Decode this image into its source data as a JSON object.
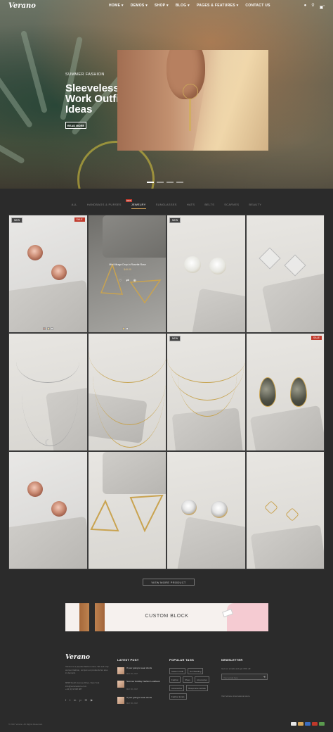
{
  "brand": {
    "logo": "Verano"
  },
  "nav": {
    "items": [
      "HOME ▾",
      "DEMOS ▾",
      "SHOP ▾",
      "BLOG ▾",
      "PAGES & FEATURES ▾",
      "CONTACT US"
    ],
    "icons": [
      "user-icon",
      "search-icon",
      "cart-icon"
    ],
    "cart_count": "0"
  },
  "hero": {
    "kicker": "SUMMER FASHION",
    "headline": "Sleeveless Work Outfit Ideas",
    "button": "READ MORE",
    "slides": 4,
    "active_slide": 1
  },
  "filters": {
    "tabs": [
      "ALL",
      "HANDBAGS & PURSES",
      "JEWELRY",
      "SUNGLASSES",
      "HATS",
      "BELTS",
      "SCARVES",
      "BEAUTY"
    ],
    "active": "JEWELRY",
    "new_badge": "NEW"
  },
  "products": {
    "badge_new": "NEW",
    "badge_sale": "SALE",
    "hover_name": "Mini Mirage Drop in Rosette Rose",
    "hover_price": "$49.00",
    "hover_stars": "☆☆☆☆☆",
    "hover_actions": [
      "♡",
      "⇄",
      "⊕"
    ]
  },
  "view_more": "VIEW MORE PRODUCT",
  "custom_block": {
    "title": "CUSTOM BLOCK"
  },
  "footer": {
    "logo": "Verano",
    "about": "Verano is a popular fashion store. We sell only women fashion, not just our products but also in demand.",
    "contact": "8838 South Avenue Drive, New York\ninfo@veranostore.com\n+44 (0) 9 838 987",
    "social": [
      "f",
      "t",
      "in",
      "p",
      "✉",
      "▶"
    ],
    "latest_post_title": "LATEST POST",
    "posts": [
      {
        "title": "If your going to wear shorts",
        "date": "MAY 20, 2017"
      },
      {
        "title": "Summer Holiday Fashion Lookbook",
        "date": "MAY 20, 2017"
      },
      {
        "title": "If your going to wear shorts",
        "date": "MAY 20, 2017"
      }
    ],
    "tags_title": "POPULAR TAGS",
    "tags": [
      "Season Outfit",
      "Our Wedding",
      "Fashion",
      "Shoes",
      "Accessories",
      "Accessories",
      "Responsive website",
      "Fashion trends"
    ],
    "newsletter_title": "NEWSLETTER",
    "newsletter_text": "Get our emails and get 15% off.",
    "newsletter_placeholder": "Your email here",
    "newsletter_visit": "Visit Verano international store",
    "copyright": "© 2017 Verano. All Rights Reserved.",
    "payments": [
      "#e8e8e8",
      "#d4a55a",
      "#3b6dbf",
      "#c0392b",
      "#5a9a4e"
    ]
  }
}
